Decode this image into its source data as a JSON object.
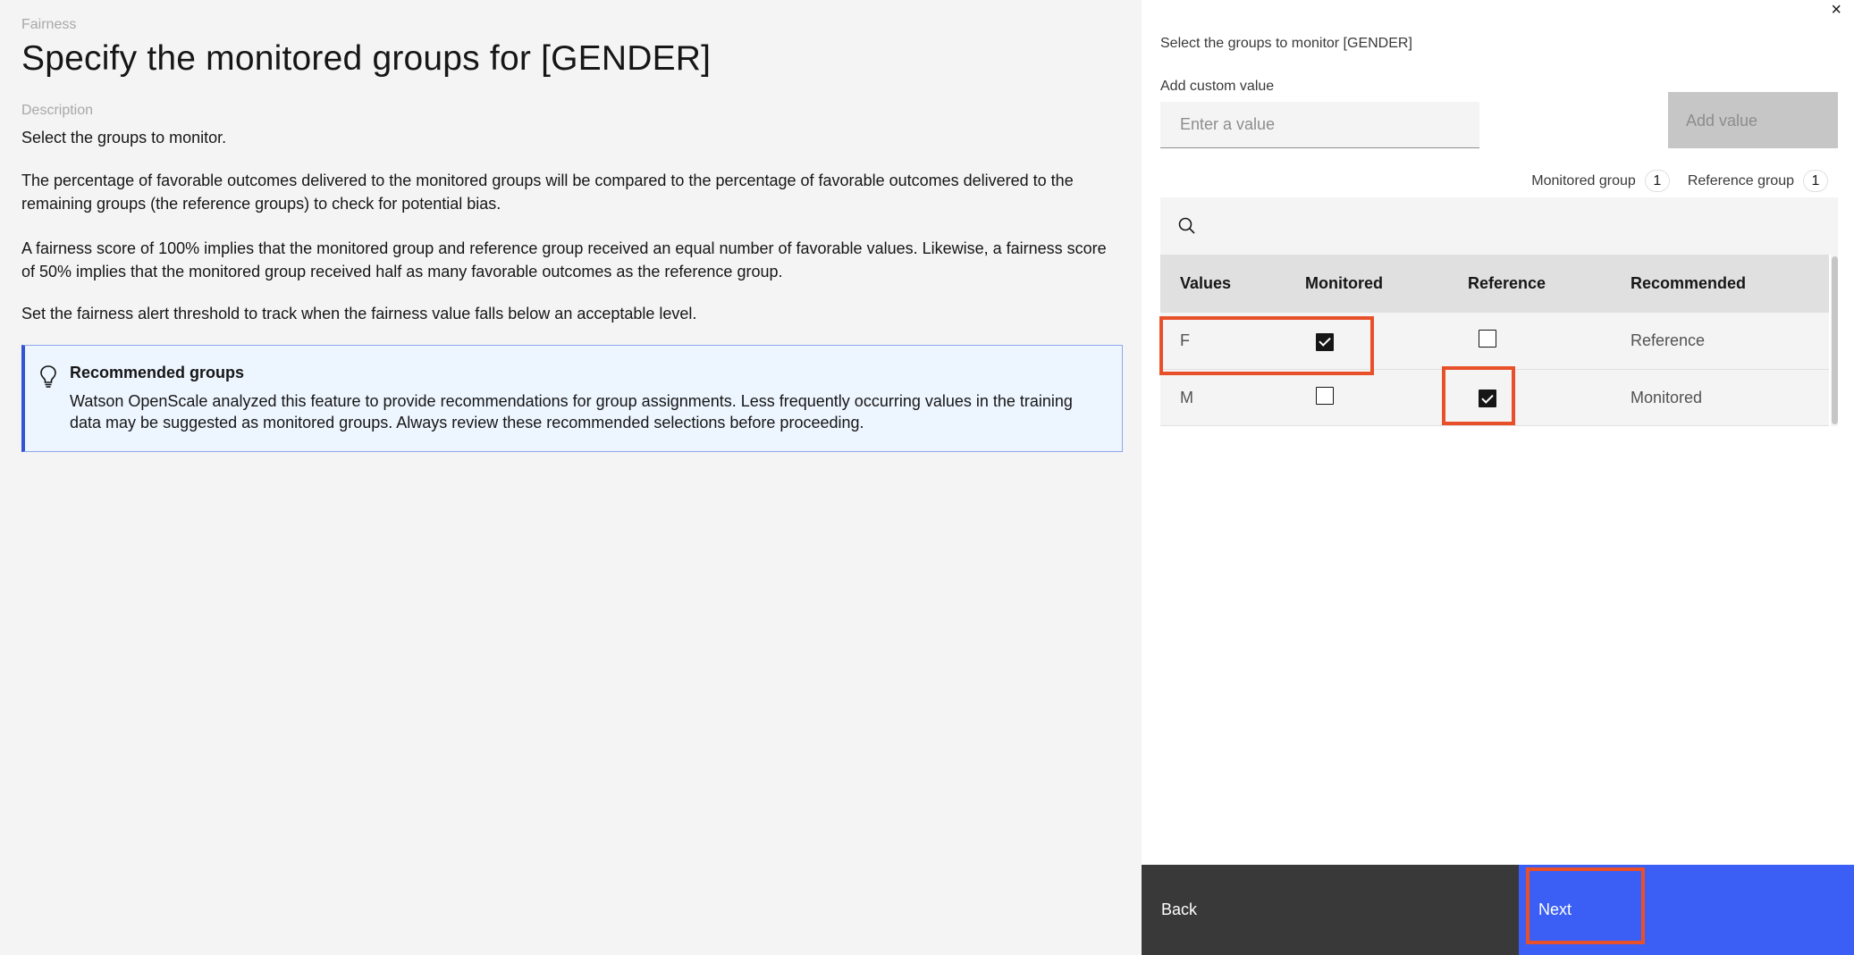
{
  "main": {
    "eyebrow": "Fairness",
    "title": "Specify the monitored groups for [GENDER]",
    "description_label": "Description",
    "paragraphs": [
      "Select the groups to monitor.",
      "The percentage of favorable outcomes delivered to the monitored groups will be compared to the percentage of favorable outcomes delivered to the remaining groups (the reference groups) to check for potential bias.",
      "A fairness score of 100% implies that the monitored group and reference group received an equal number of favorable values. Likewise, a fairness score of 50% implies that the monitored group received half as many favorable outcomes as the reference group.",
      "Set the fairness alert threshold to track when the fairness value falls below an acceptable level."
    ],
    "notice": {
      "icon": "lightbulb-icon",
      "title": "Recommended groups",
      "body": "Watson OpenScale analyzed this feature to provide recommendations for group assignments. Less frequently occurring values in the training data may be suggested as monitored groups. Always review these recommended selections before proceeding."
    }
  },
  "panel": {
    "close_icon": "×",
    "title": "Select the groups to monitor [GENDER]",
    "custom_value_label": "Add custom value",
    "custom_value_placeholder": "Enter a value",
    "custom_value": "",
    "add_value_label": "Add value",
    "counts": {
      "monitored_label": "Monitored group",
      "monitored_count": "1",
      "reference_label": "Reference group",
      "reference_count": "1"
    },
    "table": {
      "headers": [
        "Values",
        "Monitored",
        "Reference",
        "Recommended"
      ],
      "rows": [
        {
          "value": "F",
          "monitored": true,
          "reference": false,
          "recommended": "Reference"
        },
        {
          "value": "M",
          "monitored": false,
          "reference": true,
          "recommended": "Monitored"
        }
      ]
    },
    "footer": {
      "back_label": "Back",
      "next_label": "Next"
    }
  },
  "colors": {
    "primary": "#3b5ff5",
    "highlight": "#e8502a",
    "notice_border": "#3353d4"
  }
}
